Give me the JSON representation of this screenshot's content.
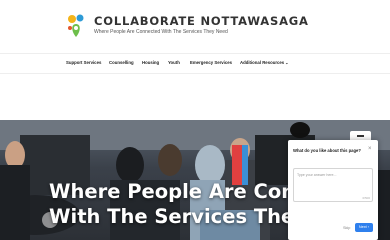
{
  "header": {
    "title": "COLLABORATE NOTTAWASAGA",
    "tagline": "Where People Are Connected With The Services They Need",
    "logo_icon": "location-pin-logo",
    "logo_colors": [
      "#f4b41a",
      "#2e9bd6",
      "#6dbf4b",
      "#e4572e"
    ]
  },
  "nav": {
    "items": [
      {
        "label": "Support Services"
      },
      {
        "label": "Counselling"
      },
      {
        "label": "Housing"
      },
      {
        "label": "Youth"
      },
      {
        "label": "Emergency Services"
      },
      {
        "label": "Additional Resources"
      }
    ],
    "dropdown_icon": "chevron-down-icon"
  },
  "hero": {
    "line1": "Where People Are Conn",
    "line2": "With The Services They"
  },
  "feedback": {
    "title": "What do you like about this page?",
    "placeholder": "Type your answer here...",
    "counter": "0/500",
    "skip_label": "Skip",
    "next_label": "Next",
    "next_color": "#2f80ed"
  }
}
